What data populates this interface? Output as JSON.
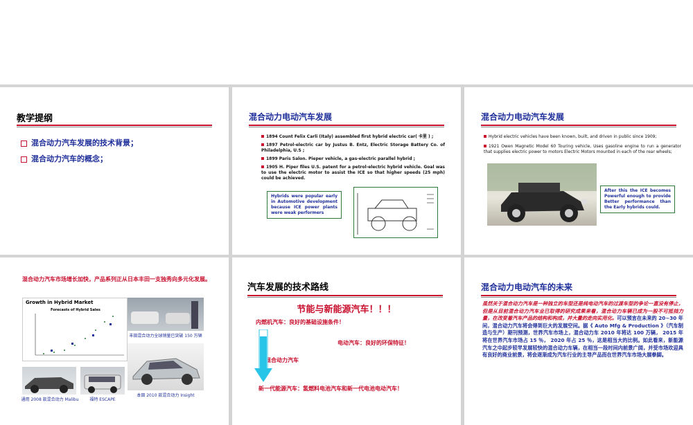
{
  "slide1": {
    "title": "教学提纲",
    "items": [
      "混合动力汽车发展的技术背景；",
      "混合动力汽车的概念；"
    ]
  },
  "slide2": {
    "title": "混合动力电动汽车发展",
    "bullets": [
      "1894 Count Felix Carli (Italy) assembled first hybrid electric car( 卡里 ) ;",
      "1897 Petrol-electric car by Justus B. Entz, Electric Storage Battery Co. of Philadelphia, U.S ;",
      "1899 Paris Salon.  Pieper vehicle, a gas-electric parallel hybrid ;",
      "1905 H. Piper files U.S. patent for a petrol-electric hybrid vehicle.  Goal was to use the electric motor to assist the ICE so that higher speeds (25 mph) could be achieved."
    ],
    "note": "Hybrids were popular early in Automotive development because ICE power plants were weak performers"
  },
  "slide3": {
    "title": "混合动力电动汽车发展",
    "bullets": [
      "Hybrid electric vehicles have been known, built, and driven in public since 1909;",
      "1921 Owen Magnetic Model 60 Touring vehicle, Uses gasoline engine to run a generator that supplies electric power to motors Electric Motors mounted in each of the rear wheels;"
    ],
    "note": "After this the ICE becomes Powerful enough to provide Better performance than the Early hybrids could."
  },
  "slide4": {
    "heading": "混合动力汽车市场增长加快，产品系列正从日本丰田一支独秀向多元化发展。",
    "chart_title": "Growth in Hybrid Market",
    "chart_subtitle": "Forecasts of Hybrid Sales",
    "captions": [
      "丰田混合动力全球销量已突破 150 万辆",
      "本田 2010 款混合动力 Insight",
      "通用 2008 款混合动力 Malibu",
      "福特 ESCAPE"
    ]
  },
  "slide5": {
    "title": "汽车发展的技术路线",
    "headline": "节能与新能源汽车！！！",
    "line1": "内燃机汽车：良好的基础设施条件！",
    "line2": "电动汽车：良好的环保特征！",
    "line3": "混合动力汽车",
    "line4": "新一代能源汽车：氢燃料电池汽车和新一代电池电动汽车！"
  },
  "slide6": {
    "title": "混合动力电动汽车的未来",
    "para_red": "虽然关于混合动力汽车是一种独立的车型还是纯电动汽车的过渡车型的争论一直没有停止，但是从目前混合动力汽车业已取得的研究成果来看，混合动力车辆已成为一股不可抵挡力量，在改变着汽车产品的结构和构成，并大量的走向实用化。",
    "para_navy": "可以预言在未来的 20~30 年间，混合动力汽车将会得到巨大的发展空间。据《 Auto Mfg & Production 》（汽车制造与生产）期刊预测，世界汽车市场上，混合动力车 2010 年将达 100 万辆， 2015 年将在世界汽车市场占 15 ％， 2020 年占 25 ％，这是相当大的比例。如此看来，新能源汽车之中起步较早发展较快的混合动力车辆，在相当一段时间内前景广阔，并受市场欢迎具有良好的商业前景，将会逐渐成为汽车行业的主导产品而在世界汽车市场大展拳脚。"
  },
  "colors": {
    "accent_red": "#c8102e",
    "navy": "#1f2f9a",
    "green_border": "#2b7a3a",
    "arrow_cyan": "#29c5e8"
  }
}
